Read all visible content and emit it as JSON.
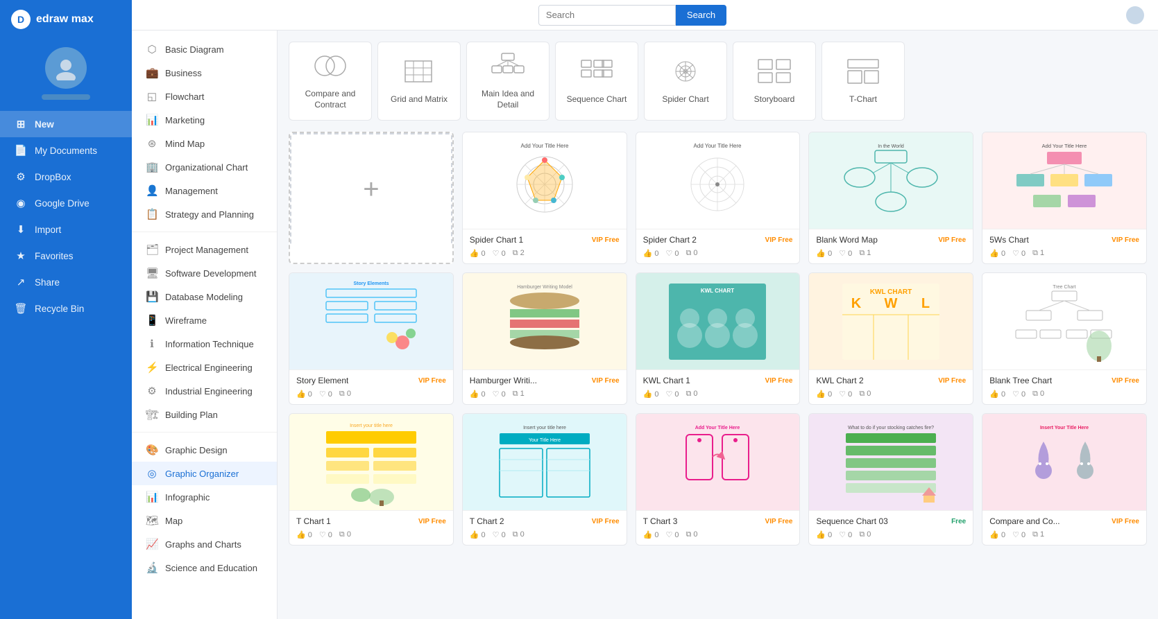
{
  "app": {
    "name": "edraw max",
    "logo_letter": "D"
  },
  "sidebar": {
    "nav_items": [
      {
        "id": "new",
        "label": "New",
        "icon": "➕",
        "active": true
      },
      {
        "id": "my-documents",
        "label": "My Documents",
        "icon": "📄"
      },
      {
        "id": "dropbox",
        "label": "DropBox",
        "icon": "⚙️"
      },
      {
        "id": "google-drive",
        "label": "Google Drive",
        "icon": "◉"
      },
      {
        "id": "import",
        "label": "Import",
        "icon": "⬇️"
      },
      {
        "id": "favorites",
        "label": "Favorites",
        "icon": "★"
      },
      {
        "id": "share",
        "label": "Share",
        "icon": "↗"
      },
      {
        "id": "recycle-bin",
        "label": "Recycle Bin",
        "icon": "🗑"
      }
    ]
  },
  "topbar": {
    "search_placeholder": "Search",
    "search_button": "Search"
  },
  "left_menu": {
    "items": [
      {
        "id": "basic-diagram",
        "label": "Basic Diagram",
        "icon": "⬡"
      },
      {
        "id": "business",
        "label": "Business",
        "icon": "💼"
      },
      {
        "id": "flowchart",
        "label": "Flowchart",
        "icon": "⬜"
      },
      {
        "id": "marketing",
        "label": "Marketing",
        "icon": "📊"
      },
      {
        "id": "mind-map",
        "label": "Mind Map",
        "icon": "⊛"
      },
      {
        "id": "org-chart",
        "label": "Organizational Chart",
        "icon": "🏢"
      },
      {
        "id": "management",
        "label": "Management",
        "icon": "👤"
      },
      {
        "id": "strategy",
        "label": "Strategy and Planning",
        "icon": "📋"
      },
      {
        "id": "divider1"
      },
      {
        "id": "project-mgmt",
        "label": "Project Management",
        "icon": "🗂"
      },
      {
        "id": "software-dev",
        "label": "Software Development",
        "icon": "🖥"
      },
      {
        "id": "database",
        "label": "Database Modeling",
        "icon": "💾"
      },
      {
        "id": "wireframe",
        "label": "Wireframe",
        "icon": "📱"
      },
      {
        "id": "info-tech",
        "label": "Information Technique",
        "icon": "ℹ"
      },
      {
        "id": "electrical",
        "label": "Electrical Engineering",
        "icon": "⚡"
      },
      {
        "id": "industrial",
        "label": "Industrial Engineering",
        "icon": "⚙"
      },
      {
        "id": "building",
        "label": "Building Plan",
        "icon": "🏗"
      },
      {
        "id": "divider2"
      },
      {
        "id": "graphic-design",
        "label": "Graphic Design",
        "icon": "🎨"
      },
      {
        "id": "graphic-organizer",
        "label": "Graphic Organizer",
        "icon": "◎",
        "active": true
      },
      {
        "id": "infographic",
        "label": "Infographic",
        "icon": "📊"
      },
      {
        "id": "map",
        "label": "Map",
        "icon": "🗺"
      },
      {
        "id": "graphs-charts",
        "label": "Graphs and Charts",
        "icon": "📈"
      },
      {
        "id": "science-edu",
        "label": "Science and Education",
        "icon": "🔬"
      }
    ]
  },
  "categories": [
    {
      "id": "compare",
      "label": "Compare and\nContract",
      "icon_type": "compare"
    },
    {
      "id": "grid",
      "label": "Grid and Matrix",
      "icon_type": "grid"
    },
    {
      "id": "main-idea",
      "label": "Main Idea and Detail",
      "icon_type": "main-idea"
    },
    {
      "id": "sequence",
      "label": "Sequence Chart",
      "icon_type": "sequence"
    },
    {
      "id": "spider",
      "label": "Spider Chart",
      "icon_type": "spider"
    },
    {
      "id": "storyboard",
      "label": "Storyboard",
      "icon_type": "storyboard"
    },
    {
      "id": "t-chart",
      "label": "T-Chart",
      "icon_type": "t-chart"
    }
  ],
  "templates": [
    {
      "id": "new",
      "type": "new"
    },
    {
      "id": "spider1",
      "name": "Spider Chart 1",
      "badge": "VIP Free",
      "badge_type": "vip",
      "likes": 0,
      "hearts": 0,
      "copies": 2,
      "thumb_type": "spider1"
    },
    {
      "id": "spider2",
      "name": "Spider Chart 2",
      "badge": "VIP Free",
      "badge_type": "vip",
      "likes": 0,
      "hearts": 0,
      "copies": 0,
      "thumb_type": "spider2"
    },
    {
      "id": "wordmap",
      "name": "Blank Word Map",
      "badge": "VIP Free",
      "badge_type": "vip",
      "likes": 0,
      "hearts": 0,
      "copies": 1,
      "thumb_type": "wordmap"
    },
    {
      "id": "5ws",
      "name": "5Ws Chart",
      "badge": "VIP Free",
      "badge_type": "vip",
      "likes": 0,
      "hearts": 0,
      "copies": 1,
      "thumb_type": "5ws"
    },
    {
      "id": "story",
      "name": "Story Element",
      "badge": "VIP Free",
      "badge_type": "vip",
      "likes": 0,
      "hearts": 0,
      "copies": 0,
      "thumb_type": "story"
    },
    {
      "id": "hamburger",
      "name": "Hamburger Writi...",
      "badge": "VIP Free",
      "badge_type": "vip",
      "likes": 0,
      "hearts": 0,
      "copies": 1,
      "thumb_type": "hamburger"
    },
    {
      "id": "kwl1",
      "name": "KWL Chart 1",
      "badge": "VIP Free",
      "badge_type": "vip",
      "likes": 0,
      "hearts": 0,
      "copies": 0,
      "thumb_type": "kwl1"
    },
    {
      "id": "kwl2",
      "name": "KWL Chart 2",
      "badge": "VIP Free",
      "badge_type": "vip",
      "likes": 0,
      "hearts": 0,
      "copies": 0,
      "thumb_type": "kwl2"
    },
    {
      "id": "tree",
      "name": "Blank Tree Chart",
      "badge": "VIP Free",
      "badge_type": "vip",
      "likes": 0,
      "hearts": 0,
      "copies": 0,
      "thumb_type": "tree"
    },
    {
      "id": "tchart1",
      "name": "T Chart 1",
      "badge": "VIP Free",
      "badge_type": "vip",
      "likes": 0,
      "hearts": 0,
      "copies": 0,
      "thumb_type": "tchart1"
    },
    {
      "id": "tchart2",
      "name": "T Chart 2",
      "badge": "VIP Free",
      "badge_type": "vip",
      "likes": 0,
      "hearts": 0,
      "copies": 0,
      "thumb_type": "tchart2"
    },
    {
      "id": "tchart3",
      "name": "T Chart 3",
      "badge": "VIP Free",
      "badge_type": "vip",
      "likes": 0,
      "hearts": 0,
      "copies": 0,
      "thumb_type": "tchart3"
    },
    {
      "id": "seq03",
      "name": "Sequence Chart 03",
      "badge": "Free",
      "badge_type": "free",
      "likes": 0,
      "hearts": 0,
      "copies": 0,
      "thumb_type": "seq03"
    },
    {
      "id": "compare",
      "name": "Compare and Co...",
      "badge": "VIP Free",
      "badge_type": "vip",
      "likes": 0,
      "hearts": 0,
      "copies": 1,
      "thumb_type": "compare"
    }
  ]
}
